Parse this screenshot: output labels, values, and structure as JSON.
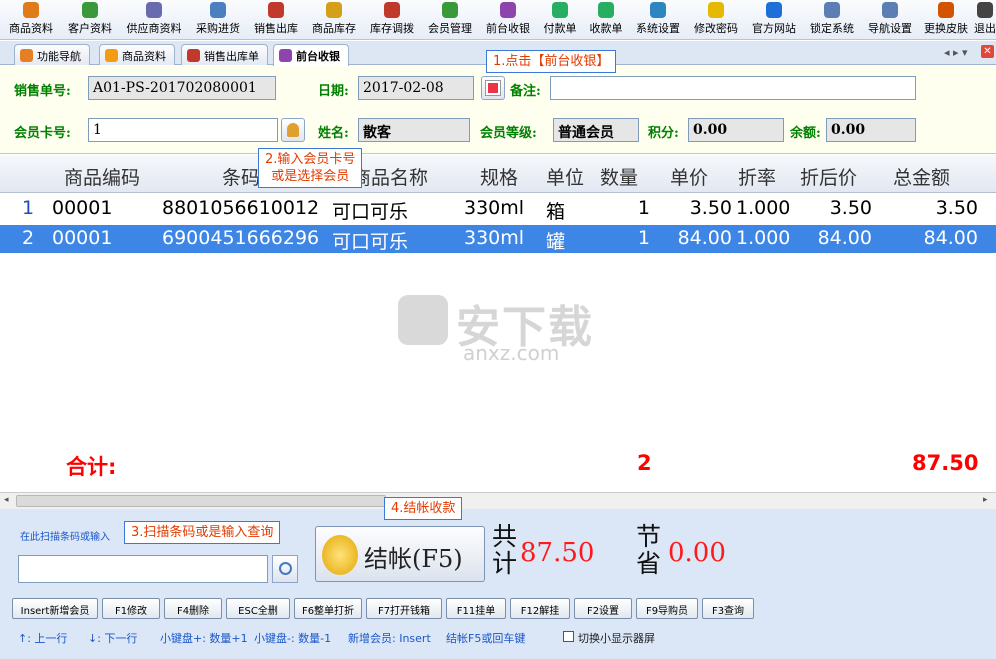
{
  "toolbar": {
    "items": [
      {
        "label": "商品资料",
        "icon": "goods-icon",
        "color": "#e07b1a"
      },
      {
        "label": "客户资料",
        "icon": "customer-icon",
        "color": "#3a9a3a"
      },
      {
        "label": "供应商资料",
        "icon": "supplier-icon",
        "color": "#6a6ab0"
      },
      {
        "label": "采购进货",
        "icon": "purchase-icon",
        "color": "#4a7fc0"
      },
      {
        "label": "销售出库",
        "icon": "sales-out-icon",
        "color": "#c0392b"
      },
      {
        "label": "商品库存",
        "icon": "stock-icon",
        "color": "#d4a017"
      },
      {
        "label": "库存调拨",
        "icon": "transfer-icon",
        "color": "#c0392b"
      },
      {
        "label": "会员管理",
        "icon": "member-icon",
        "color": "#3a9a3a"
      },
      {
        "label": "前台收银",
        "icon": "cashier-icon",
        "color": "#8e44ad"
      },
      {
        "label": "付款单",
        "icon": "payment-icon",
        "color": "#27ae60"
      },
      {
        "label": "收款单",
        "icon": "receipt-icon",
        "color": "#27ae60"
      },
      {
        "label": "系统设置",
        "icon": "settings-icon",
        "color": "#2e86c1"
      },
      {
        "label": "修改密码",
        "icon": "password-icon",
        "color": "#e6b800"
      },
      {
        "label": "官方网站",
        "icon": "website-icon",
        "color": "#1e6fd9"
      },
      {
        "label": "锁定系统",
        "icon": "lock-icon",
        "color": "#5b7fb5"
      },
      {
        "label": "导航设置",
        "icon": "nav-settings-icon",
        "color": "#5b7fb5"
      },
      {
        "label": "更换皮肤",
        "icon": "skin-icon",
        "color": "#d35400"
      },
      {
        "label": "退出",
        "icon": "exit-icon",
        "color": "#444444"
      }
    ]
  },
  "tabs": [
    {
      "label": "功能导航",
      "color": "#e67e22"
    },
    {
      "label": "商品资料",
      "color": "#f39c12"
    },
    {
      "label": "销售出库单",
      "color": "#c0392b"
    },
    {
      "label": "前台收银",
      "color": "#8e44ad"
    }
  ],
  "form": {
    "sale_no_label": "销售单号:",
    "sale_no": "A01-PS-201702080001",
    "date_label": "日期:",
    "date": "2017-02-08",
    "remark_label": "备注:",
    "remark": "",
    "member_card_label": "会员卡号:",
    "member_card": "1",
    "name_label": "姓名:",
    "name": "散客",
    "level_label": "会员等级:",
    "level": "普通会员",
    "points_label": "积分:",
    "points": "0.00",
    "balance_label": "余额:",
    "balance": "0.00"
  },
  "grid": {
    "headers": [
      "商品编码",
      "条码",
      "商品名称",
      "规格",
      "单位",
      "数量",
      "单价",
      "折率",
      "折后价",
      "总金额"
    ],
    "rows": [
      {
        "no": "1",
        "code": "00001",
        "barcode": "8801056610012",
        "name": "可口可乐",
        "spec": "330ml",
        "unit": "箱",
        "qty": "1",
        "price": "3.50",
        "rate": "1.000",
        "disc_price": "3.50",
        "amount": "3.50"
      },
      {
        "no": "2",
        "code": "00001",
        "barcode": "6900451666296",
        "name": "可口可乐",
        "spec": "330ml",
        "unit": "罐",
        "qty": "1",
        "price": "84.00",
        "rate": "1.000",
        "disc_price": "84.00",
        "amount": "84.00"
      }
    ],
    "total_label": "合计:",
    "total_qty": "2",
    "total_amount": "87.50"
  },
  "watermark": {
    "text": "安下载",
    "sub": "anxz.com"
  },
  "bottom": {
    "scan_label": "在此扫描条码或输入",
    "scan_value": "",
    "checkout_label": "结帐(F5)",
    "total_label": "共计",
    "total_value": "87.50",
    "save_label": "节省",
    "save_value": "0.00",
    "buttons": [
      "Insert新增会员",
      "F1修改",
      "F4删除",
      "ESC全删",
      "F6整单打折",
      "F7打开钱箱",
      "F11挂单",
      "F12解挂",
      "F2设置",
      "F9导购员",
      "F3查询"
    ],
    "hints": [
      "↑: 上一行",
      "↓: 下一行",
      "小键盘+: 数量+1",
      "小键盘-: 数量-1",
      "新增会员: Insert",
      "结帐F5或回车键"
    ],
    "small_screen_label": "切换小显示器屏"
  },
  "callouts": {
    "c1": "1.点击【前台收银】",
    "c2": "2.输入会员卡号\n或是选择会员",
    "c3": "3.扫描条码或是输入查询",
    "c4": "4.结帐收款"
  },
  "colors": {
    "accent": "#3d86e6",
    "label_green": "#008000",
    "total_red": "#ff0000",
    "callout_border": "#3b78d8"
  }
}
